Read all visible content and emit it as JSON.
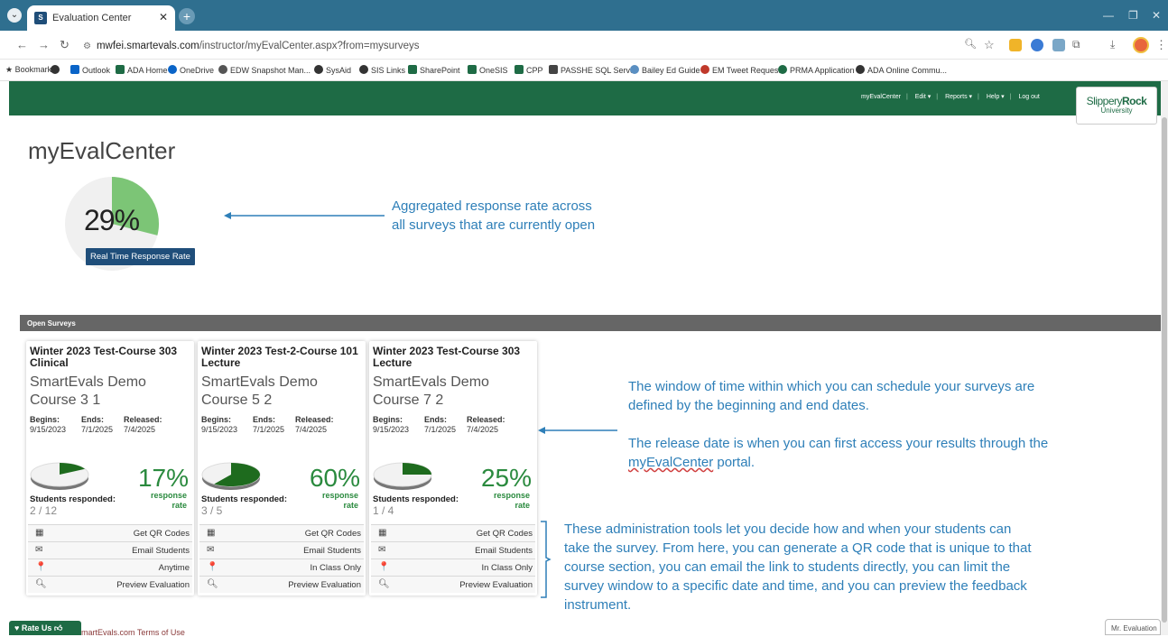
{
  "browser": {
    "tab_title": "Evaluation Center",
    "url_host": "mwfei.smartevals.com",
    "url_path": "/instructor/myEvalCenter.aspx?from=mysurveys",
    "bookmarks": [
      "Bookmarks",
      "Outlook",
      "ADA Home",
      "OneDrive",
      "EDW Snapshot Man...",
      "SysAid",
      "SIS Links",
      "SharePoint",
      "OneSIS",
      "CPP",
      "PASSHE SQL Server",
      "Bailey Ed Guide",
      "EM Tweet Request",
      "PRMA Application",
      "ADA Online Commu..."
    ]
  },
  "header": {
    "nav": [
      "myEvalCenter",
      "Edit ▾",
      "Reports ▾",
      "Help ▾",
      "Log out"
    ],
    "logo_line1_a": "Slippery",
    "logo_line1_b": "Rock",
    "logo_line2": "University"
  },
  "page_title": "myEvalCenter",
  "realtime": {
    "percent_text": "29%",
    "percent": 29,
    "label": "Real Time Response Rate"
  },
  "annotations": {
    "rt_line1": "Aggregated response rate across",
    "rt_line2": "all surveys that are currently open",
    "dates_p1_line1": "The window of time within which you can schedule your surveys are",
    "dates_p1_line2": "defined by the beginning and end dates.",
    "dates_p2_line1": "The release date is when you can first access your results through the",
    "dates_p2_line2": "myEvalCenter",
    "dates_p2_line2b": " portal.",
    "tools_line1": "These administration tools let you decide how and when your students can",
    "tools_line2": "take the survey. From here, you can generate a QR code that is unique to that",
    "tools_line3": "course section, you can email the link to students directly, you can limit the",
    "tools_line4": "survey window to a specific date and time, and you can preview the feedback",
    "tools_line5": "instrument."
  },
  "surveys_bar": "Open Surveys",
  "date_labels": {
    "begins": "Begins:",
    "ends": "Ends:",
    "released": "Released:"
  },
  "resp_label": "Students responded:",
  "rate_label_1": "response",
  "rate_label_2": "rate",
  "cards": [
    {
      "title": "Winter 2023 Test-Course 303 Clinical",
      "name": "SmartEvals Demo Course 3 1",
      "begins": "9/15/2023",
      "ends": "7/1/2025",
      "released": "7/4/2025",
      "percent_text": "17%",
      "percent": 17,
      "count": "2 / 12",
      "tools": [
        "Get QR Codes",
        "Email Students",
        "Anytime",
        "Preview Evaluation"
      ]
    },
    {
      "title": "Winter 2023 Test-2-Course 101 Lecture",
      "name": "SmartEvals Demo Course 5 2",
      "begins": "9/15/2023",
      "ends": "7/1/2025",
      "released": "7/4/2025",
      "percent_text": "60%",
      "percent": 60,
      "count": "3 / 5",
      "tools": [
        "Get QR Codes",
        "Email Students",
        "In Class Only",
        "Preview Evaluation"
      ]
    },
    {
      "title": "Winter 2023 Test-Course 303 Lecture",
      "name": "SmartEvals Demo Course 7 2",
      "begins": "9/15/2023",
      "ends": "7/1/2025",
      "released": "7/4/2025",
      "percent_text": "25%",
      "percent": 25,
      "count": "1 / 4",
      "tools": [
        "Get QR Codes",
        "Email Students",
        "In Class Only",
        "Preview Evaluation"
      ]
    }
  ],
  "footer": {
    "rate_us": "Rate Us",
    "terms": "martEvals.com Terms of Use",
    "mr_eval": "Mr. Evaluation"
  },
  "colors": {
    "accent_green": "#1e6b45",
    "pie_green": "#7cc576",
    "pct_green": "#2a8a3e",
    "annotation_blue": "#2e7fb8"
  }
}
